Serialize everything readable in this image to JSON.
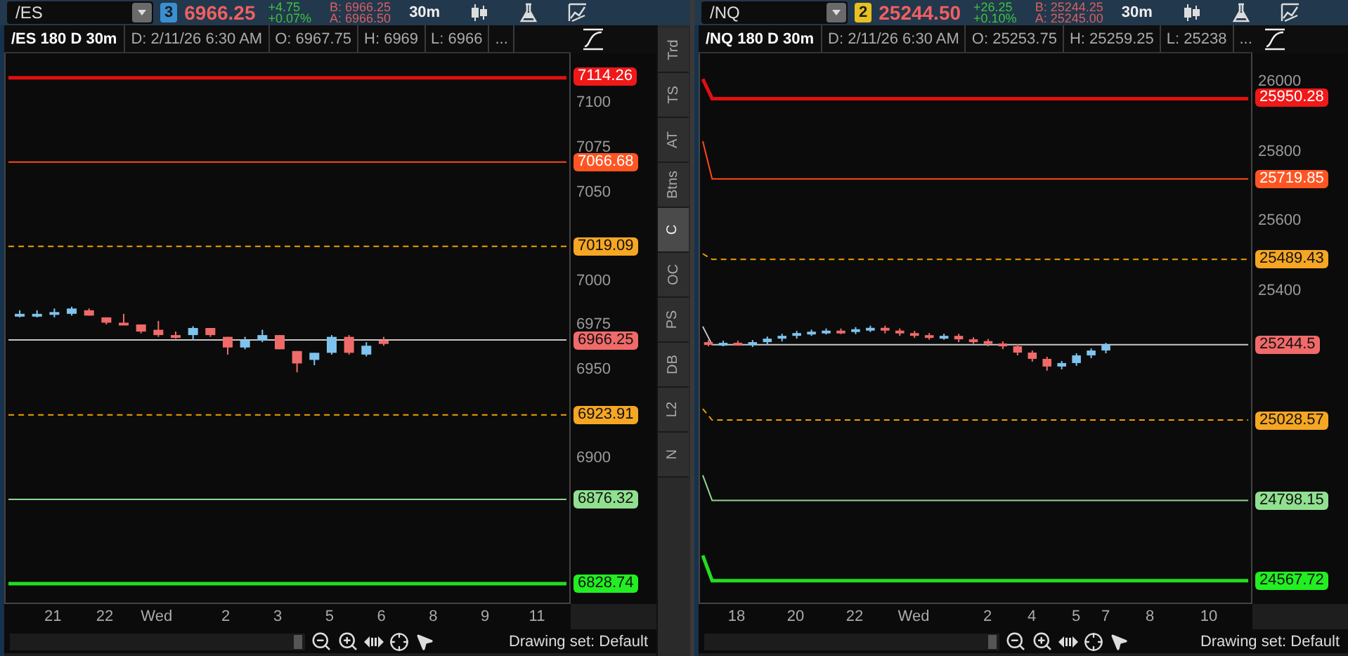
{
  "panels": [
    {
      "toolbar": {
        "symbol": "/ES",
        "link": {
          "label": "3",
          "color": "#3a8fd0"
        },
        "last": "6966.25",
        "change": "+4.75",
        "change_pct": "+0.07%",
        "bid": "B: 6966.25",
        "ask": "A: 6966.50",
        "aggregation": "30m"
      },
      "header": {
        "title": "/ES 180 D 30m",
        "fields": [
          "D: 2/11/26 6:30 AM",
          "O: 6967.75",
          "H: 6969",
          "L: 6966",
          "..."
        ]
      },
      "chart_data": {
        "type": "candlestick",
        "ylim": [
          6818,
          7128
        ],
        "yticks": [
          7100,
          7075,
          7050,
          7000,
          6975,
          6950,
          6900
        ],
        "categories": [
          null,
          null,
          "21",
          null,
          null,
          "22",
          null,
          null,
          "Wed",
          null,
          null,
          null,
          "2",
          null,
          null,
          "3",
          null,
          null,
          "5",
          null,
          null,
          "6",
          null,
          null,
          "8",
          null,
          null,
          "9",
          null,
          null,
          "11",
          null
        ],
        "ohlc": [
          [
            6981,
            6983,
            6979,
            6981
          ],
          [
            6981,
            6983,
            6979,
            6981
          ],
          [
            6981,
            6984,
            6979,
            6982
          ],
          [
            6981,
            6985,
            6980,
            6984
          ],
          [
            6983,
            6984,
            6980,
            6980
          ],
          [
            6979,
            6979,
            6975,
            6976
          ],
          [
            6976,
            6981,
            6975,
            6975
          ],
          [
            6975,
            6975,
            6970,
            6971
          ],
          [
            6972,
            6977,
            6968,
            6969
          ],
          [
            6969,
            6971,
            6967,
            6968
          ],
          [
            6969,
            6974,
            6966,
            6973
          ],
          [
            6973,
            6973,
            6968,
            6969
          ],
          [
            6968,
            6968,
            6958,
            6962
          ],
          [
            6962,
            6968,
            6961,
            6966
          ],
          [
            6966,
            6972,
            6965,
            6969
          ],
          [
            6969,
            6969,
            6961,
            6961
          ],
          [
            6960,
            6960,
            6948,
            6953
          ],
          [
            6955,
            6959,
            6952,
            6959
          ],
          [
            6959,
            6969,
            6958,
            6968
          ],
          [
            6968,
            6969,
            6958,
            6959
          ],
          [
            6958,
            6965,
            6957,
            6963
          ],
          [
            6966,
            6968,
            6963,
            6964
          ],
          null,
          null,
          null,
          null,
          null,
          null,
          null,
          null,
          null,
          null
        ],
        "ref_lines": [
          {
            "axis": "y",
            "value": 7114.26,
            "label": "7114.26",
            "color": "#e01010"
          },
          {
            "axis": "y",
            "value": 7066.68,
            "label": "7066.68",
            "color": "#ff4a1a"
          },
          {
            "axis": "y",
            "value": 7019.09,
            "label": "7019.09",
            "color": "#f0a000"
          },
          {
            "axis": "y",
            "value": 6966.25,
            "label": "6966.25",
            "color": "#c8c8c8"
          },
          {
            "axis": "y",
            "value": 6923.91,
            "label": "6923.91",
            "color": "#f0a000"
          },
          {
            "axis": "y",
            "value": 6876.32,
            "label": "6876.32",
            "color": "#8fd88f"
          },
          {
            "axis": "y",
            "value": 6828.74,
            "label": "6828.74",
            "color": "#22dd22"
          }
        ]
      },
      "price_labels": [
        {
          "color": "#f01818"
        },
        {
          "color": "#ff5522"
        },
        {
          "color": "#f5a623"
        },
        {
          "color": "#f06a6a"
        },
        {
          "color": "#f5a623"
        },
        {
          "color": "#90e090"
        },
        {
          "color": "#22ee22"
        }
      ],
      "lines_slope_in": false,
      "side_tabs": [
        {
          "label": "Trd",
          "selected": false
        },
        {
          "label": "TS",
          "selected": false
        },
        {
          "label": "AT",
          "selected": false
        },
        {
          "label": "Btns",
          "selected": false
        },
        {
          "label": "C",
          "selected": true
        },
        {
          "label": "OC",
          "selected": false
        },
        {
          "label": "PS",
          "selected": false
        },
        {
          "label": "DB",
          "selected": false
        },
        {
          "label": "L2",
          "selected": false
        },
        {
          "label": "N",
          "selected": false
        }
      ],
      "drawing_set": "Drawing set: Default"
    },
    {
      "toolbar": {
        "symbol": "/NQ",
        "link": {
          "label": "2",
          "color": "#e8c020"
        },
        "last": "25244.50",
        "change": "+26.25",
        "change_pct": "+0.10%",
        "bid": "B: 25244.25",
        "ask": "A: 25245.00",
        "aggregation": "30m"
      },
      "header": {
        "title": "/NQ 180 D 30m",
        "fields": [
          "D: 2/11/26 6:30 AM",
          "O: 25253.75",
          "H: 25259.25",
          "L: 25238",
          "..."
        ]
      },
      "chart_data": {
        "type": "candlestick",
        "ylim": [
          24505,
          26080
        ],
        "yticks": [
          26000,
          25800,
          25600,
          25400
        ],
        "categories": [
          null,
          null,
          "18",
          null,
          null,
          null,
          "20",
          null,
          null,
          null,
          "22",
          null,
          null,
          null,
          "Wed",
          null,
          null,
          null,
          null,
          "2",
          null,
          null,
          "4",
          null,
          null,
          "5",
          null,
          "7",
          null,
          null,
          "8",
          null,
          null,
          null,
          "10",
          null,
          null
        ],
        "ohlc": [
          [
            25252,
            25258,
            25240,
            25248
          ],
          [
            25248,
            25256,
            25240,
            25250
          ],
          [
            25250,
            25256,
            25242,
            25246
          ],
          [
            25246,
            25258,
            25238,
            25252
          ],
          [
            25252,
            25268,
            25244,
            25262
          ],
          [
            25262,
            25276,
            25254,
            25270
          ],
          [
            25270,
            25284,
            25262,
            25278
          ],
          [
            25278,
            25288,
            25270,
            25282
          ],
          [
            25282,
            25291,
            25274,
            25285
          ],
          [
            25285,
            25291,
            25275,
            25283
          ],
          [
            25283,
            25295,
            25275,
            25289
          ],
          [
            25289,
            25299,
            25281,
            25293
          ],
          [
            25293,
            25299,
            25277,
            25285
          ],
          [
            25285,
            25291,
            25270,
            25278
          ],
          [
            25278,
            25284,
            25264,
            25272
          ],
          [
            25272,
            25278,
            25259,
            25267
          ],
          [
            25267,
            25276,
            25259,
            25270
          ],
          [
            25270,
            25276,
            25252,
            25260
          ],
          [
            25260,
            25266,
            25247,
            25255
          ],
          [
            25255,
            25261,
            25240,
            25248
          ],
          [
            25248,
            25254,
            25232,
            25240
          ],
          [
            25240,
            25246,
            25214,
            25222
          ],
          [
            25222,
            25228,
            25196,
            25204
          ],
          [
            25204,
            25210,
            25170,
            25182
          ],
          [
            25182,
            25198,
            25174,
            25192
          ],
          [
            25192,
            25220,
            25184,
            25214
          ],
          [
            25214,
            25234,
            25206,
            25228
          ],
          [
            25228,
            25250,
            25220,
            25244
          ],
          null,
          null,
          null,
          null,
          null,
          null,
          null,
          null,
          null
        ],
        "ref_lines": [
          {
            "axis": "y",
            "value": 25950.28,
            "label": "25950.28",
            "color": "#e01010"
          },
          {
            "axis": "y",
            "value": 25719.85,
            "label": "25719.85",
            "color": "#ff4a1a"
          },
          {
            "axis": "y",
            "value": 25489.43,
            "label": "25489.43",
            "color": "#f0a000"
          },
          {
            "axis": "y",
            "value": 25244.5,
            "label": "25244.5",
            "color": "#c8c8c8"
          },
          {
            "axis": "y",
            "value": 25028.57,
            "label": "25028.57",
            "color": "#f0a000"
          },
          {
            "axis": "y",
            "value": 24798.15,
            "label": "24798.15",
            "color": "#8fd88f"
          },
          {
            "axis": "y",
            "value": 24567.72,
            "label": "24567.72",
            "color": "#22dd22"
          }
        ]
      },
      "price_labels": [
        {
          "color": "#f01818"
        },
        {
          "color": "#ff5522"
        },
        {
          "color": "#f5a623"
        },
        {
          "color": "#f06a6a"
        },
        {
          "color": "#f5a623"
        },
        {
          "color": "#90e090"
        },
        {
          "color": "#22ee22"
        }
      ],
      "lines_slope_in": true,
      "drawing_set": "Drawing set: Default"
    }
  ]
}
